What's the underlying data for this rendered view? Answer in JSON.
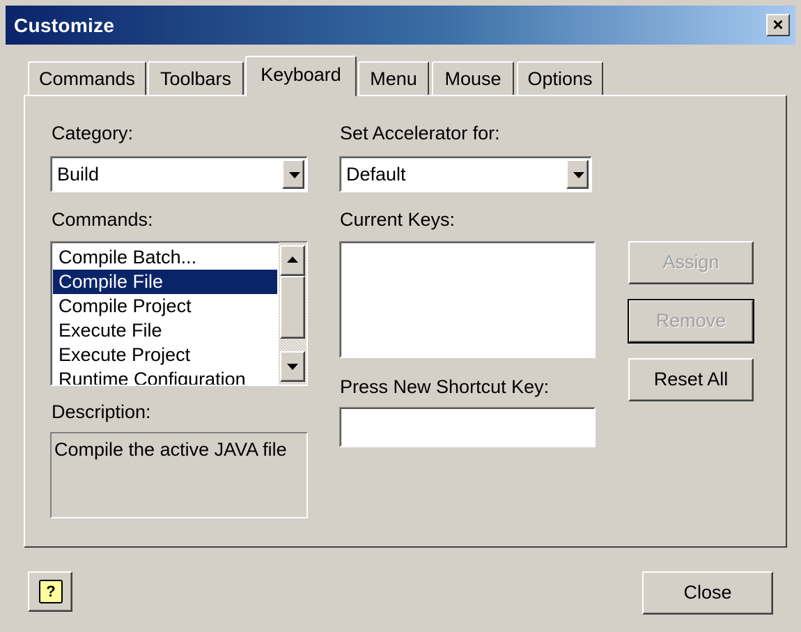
{
  "window": {
    "title": "Customize",
    "close_glyph": "×"
  },
  "tabs": [
    {
      "label": "Commands"
    },
    {
      "label": "Toolbars"
    },
    {
      "label": "Keyboard",
      "active": true
    },
    {
      "label": "Menu"
    },
    {
      "label": "Mouse"
    },
    {
      "label": "Options"
    }
  ],
  "category": {
    "label": "Category:",
    "value": "Build"
  },
  "accelerator": {
    "label": "Set Accelerator for:",
    "value": "Default"
  },
  "commands": {
    "label": "Commands:",
    "items": [
      "Compile Batch...",
      "Compile File",
      "Compile Project",
      "Execute File",
      "Execute Project",
      "Runtime Configuration"
    ],
    "selected_index": 1
  },
  "current_keys": {
    "label": "Current Keys:",
    "items": []
  },
  "shortcut": {
    "label": "Press New Shortcut Key:",
    "value": ""
  },
  "description": {
    "label": "Description:",
    "text": "Compile the active JAVA file"
  },
  "buttons": {
    "assign": "Assign",
    "remove": "Remove",
    "reset_all": "Reset All",
    "close": "Close",
    "help_glyph": "?"
  },
  "icons": {
    "dropdown": "chevron-down-icon",
    "scroll_up": "arrow-up-icon",
    "scroll_down": "arrow-down-icon",
    "help": "help-icon"
  },
  "colors": {
    "selection": "#0a246a",
    "title_start": "#0a246a",
    "title_end": "#a6caf0",
    "face": "#d4d0c8"
  }
}
